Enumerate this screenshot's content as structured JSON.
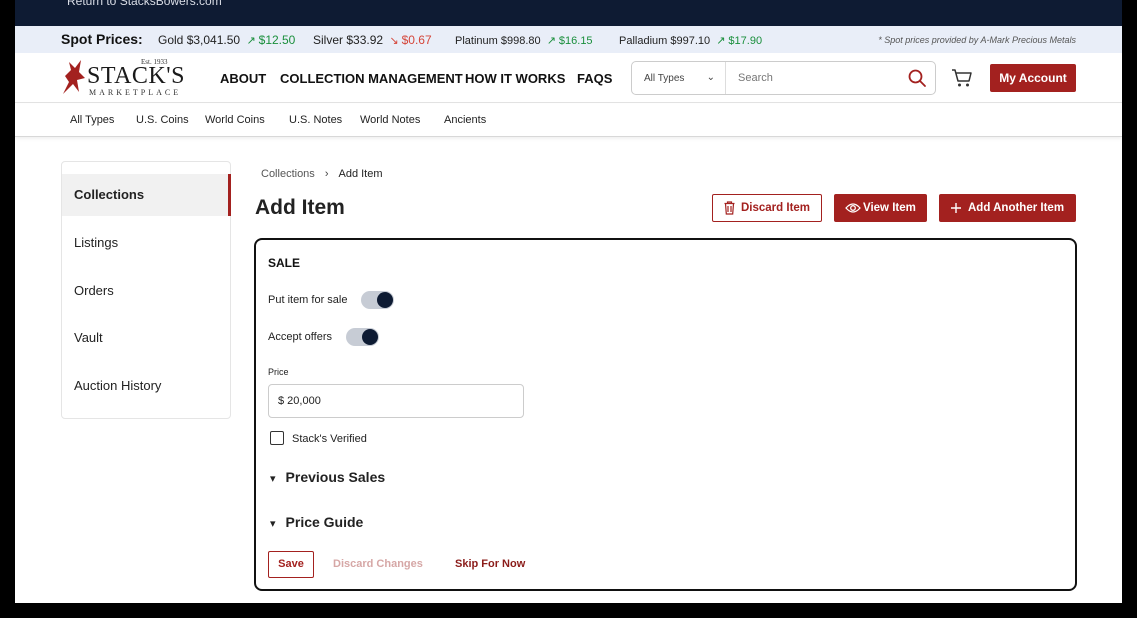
{
  "topbar": {
    "return_text": "Return to StacksBowers.com"
  },
  "spot_prices": {
    "label": "Spot Prices:",
    "items": [
      {
        "metal": "Gold",
        "price": "$3,041.50",
        "change": "$12.50",
        "direction": "up"
      },
      {
        "metal": "Silver",
        "price": "$33.92",
        "change": "$0.67",
        "direction": "down"
      },
      {
        "metal": "Platinum",
        "price": "$998.80",
        "change": "$16.15",
        "direction": "up"
      },
      {
        "metal": "Palladium",
        "price": "$997.10",
        "change": "$17.90",
        "direction": "up"
      }
    ],
    "note": "* Spot prices provided by A-Mark Precious Metals",
    "up_color": "#1a8f3c",
    "down_color": "#d5463a"
  },
  "logo": {
    "est": "Est. 1933",
    "name": "STACK'S",
    "sub": "MARKETPLACE"
  },
  "nav": {
    "about": "ABOUT",
    "collection_management": "COLLECTION MANAGEMENT",
    "how_it_works": "HOW IT WORKS",
    "faqs": "FAQS"
  },
  "search": {
    "type_value": "All Types",
    "placeholder": "Search",
    "icon": "search-icon"
  },
  "cart": {
    "icon": "cart-icon"
  },
  "account": {
    "label": "My Account"
  },
  "subnav": [
    "All Types",
    "U.S. Coins",
    "World Coins",
    "U.S. Notes",
    "World Notes",
    "Ancients"
  ],
  "sidebar": {
    "items": [
      {
        "label": "Collections",
        "active": true
      },
      {
        "label": "Listings"
      },
      {
        "label": "Orders"
      },
      {
        "label": "Vault"
      },
      {
        "label": "Auction History"
      }
    ]
  },
  "breadcrumb": {
    "parent": "Collections",
    "current": "Add Item"
  },
  "page": {
    "title": "Add Item"
  },
  "actions": {
    "discard": "Discard Item",
    "view": "View Item",
    "add_another": "Add Another Item"
  },
  "sale": {
    "heading": "SALE",
    "put_for_sale": {
      "label": "Put item for sale",
      "on": true
    },
    "accept_offers": {
      "label": "Accept offers",
      "on": true
    },
    "price_label": "Price",
    "price_value": "$ 20,000",
    "verified": {
      "label": "Stack's Verified",
      "checked": false
    },
    "previous_sales": "Previous Sales",
    "price_guide": "Price Guide",
    "save": "Save",
    "discard_changes": "Discard Changes",
    "skip": "Skip For Now"
  },
  "colors": {
    "brand": "#a3211f",
    "navy": "#0e1b33"
  }
}
